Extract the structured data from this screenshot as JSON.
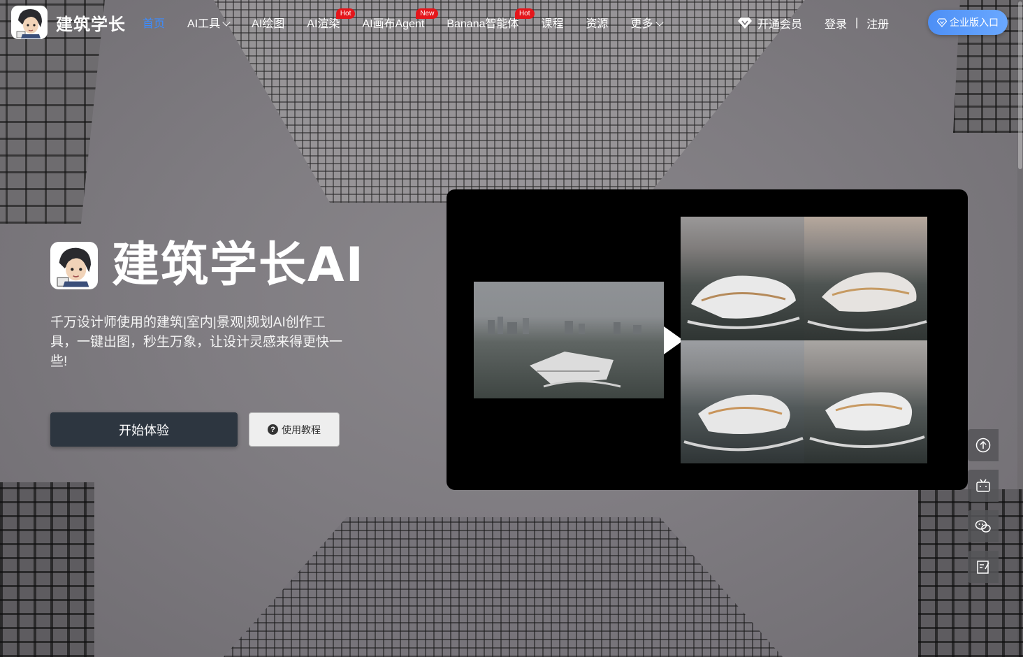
{
  "header": {
    "logo_text": "建筑学长",
    "nav": [
      {
        "label": "首页",
        "active": true
      },
      {
        "label": "AI工具",
        "dropdown": true
      },
      {
        "label": "AI绘图"
      },
      {
        "label": "AI渲染",
        "badge": "Hot"
      },
      {
        "label": "AI画布Agent",
        "badge": "New"
      },
      {
        "label": "Banana智能体",
        "badge": "Hot"
      },
      {
        "label": "课程"
      },
      {
        "label": "资源"
      },
      {
        "label": "更多",
        "dropdown": true
      }
    ],
    "vip_label": "开通会员",
    "login_label": "登录",
    "separator": "|",
    "register_label": "注册",
    "enterprise_label": "企业版入口"
  },
  "hero": {
    "title": "建筑学长AI",
    "description": "千万设计师使用的建筑|室内|景观|规划AI创作工具，一键出图，秒生万象，让设计灵感来得更快一些!",
    "start_button": "开始体验",
    "tutorial_button": "使用教程",
    "tutorial_icon_glyph": "?"
  },
  "showcase": {
    "play_icon": "play-icon"
  },
  "side_tools": [
    {
      "icon": "arrow-up-circle-icon"
    },
    {
      "icon": "bilibili-tv-icon"
    },
    {
      "icon": "wechat-icon"
    },
    {
      "icon": "feedback-edit-icon"
    }
  ],
  "colors": {
    "accent": "#3c8cff",
    "badge": "#e4161b",
    "start_button": "#2d3640",
    "enterprise_from": "#4d8ff5",
    "enterprise_to": "#6aa8ff"
  }
}
